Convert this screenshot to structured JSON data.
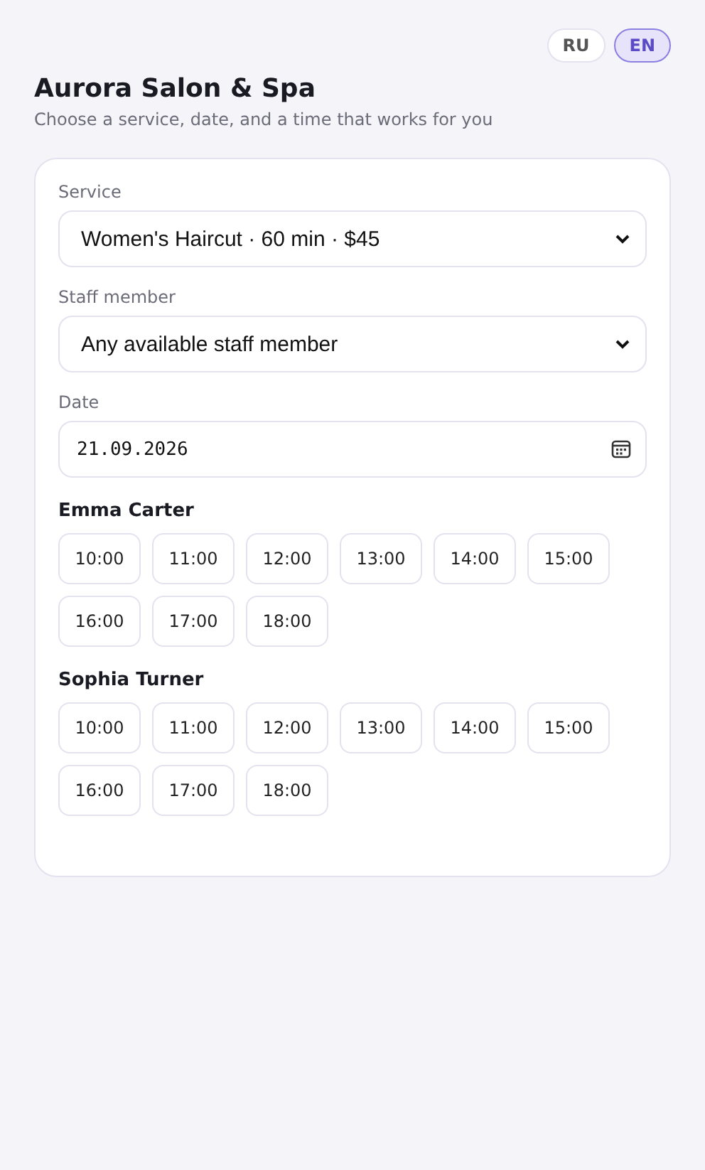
{
  "languages": [
    {
      "label": "RU",
      "selected": false
    },
    {
      "label": "EN",
      "selected": true
    }
  ],
  "title": "Aurora Salon & Spa",
  "subtitle": "Choose a service, date, and a time that works for you",
  "fields": [
    {
      "kind": "select",
      "label": "Service",
      "value": "Women's Haircut · 60 min · $45"
    },
    {
      "kind": "select",
      "label": "Staff member",
      "value": "Any available staff member"
    },
    {
      "kind": "date",
      "label": "Date",
      "value": "21.09.2026"
    }
  ],
  "staff": [
    {
      "name": "Emma Carter",
      "slots": [
        {
          "time": "10:00",
          "selected": false
        },
        {
          "time": "11:00",
          "selected": false
        },
        {
          "time": "12:00",
          "selected": false
        },
        {
          "time": "13:00",
          "selected": false
        },
        {
          "time": "14:00",
          "selected": false
        },
        {
          "time": "15:00",
          "selected": false
        },
        {
          "time": "16:00",
          "selected": false
        },
        {
          "time": "17:00",
          "selected": false
        },
        {
          "time": "18:00",
          "selected": false
        }
      ]
    },
    {
      "name": "Sophia Turner",
      "slots": [
        {
          "time": "10:00",
          "selected": false
        },
        {
          "time": "11:00",
          "selected": false
        },
        {
          "time": "12:00",
          "selected": false
        },
        {
          "time": "13:00",
          "selected": false
        },
        {
          "time": "14:00",
          "selected": false
        },
        {
          "time": "15:00",
          "selected": false
        },
        {
          "time": "16:00",
          "selected": false
        },
        {
          "time": "17:00",
          "selected": false
        },
        {
          "time": "18:00",
          "selected": false
        }
      ]
    }
  ]
}
